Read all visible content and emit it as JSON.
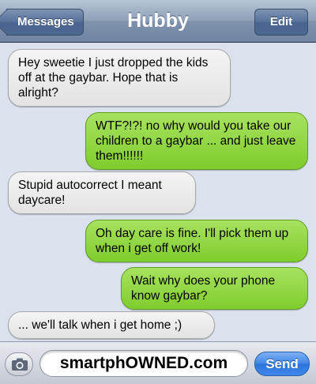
{
  "navbar": {
    "back_label": "Messages",
    "title": "Hubby",
    "edit_label": "Edit"
  },
  "messages": [
    {
      "side": "in",
      "text": "Hey sweetie I just dropped the kids off at the gaybar. Hope that is alright?"
    },
    {
      "side": "out",
      "text": "WTF?!?! no why would you take our children to a gaybar ... and just leave them!!!!!!"
    },
    {
      "side": "in",
      "text": "Stupid autocorrect I meant daycare!"
    },
    {
      "side": "out",
      "text": "Oh day care is fine. I'll pick them up when i get off work!"
    },
    {
      "side": "out",
      "text": "Wait why does your phone know gaybar?"
    },
    {
      "side": "in",
      "text": "... we'll talk when i get home ;)"
    }
  ],
  "input": {
    "camera_icon": "camera-icon",
    "text_value": "smartphOWNED.com",
    "send_label": "Send"
  },
  "colors": {
    "incoming_bubble": "#e8e8e8",
    "outgoing_bubble": "#8fd540",
    "background": "#dbe2ed",
    "send_button": "#3f86e8"
  }
}
